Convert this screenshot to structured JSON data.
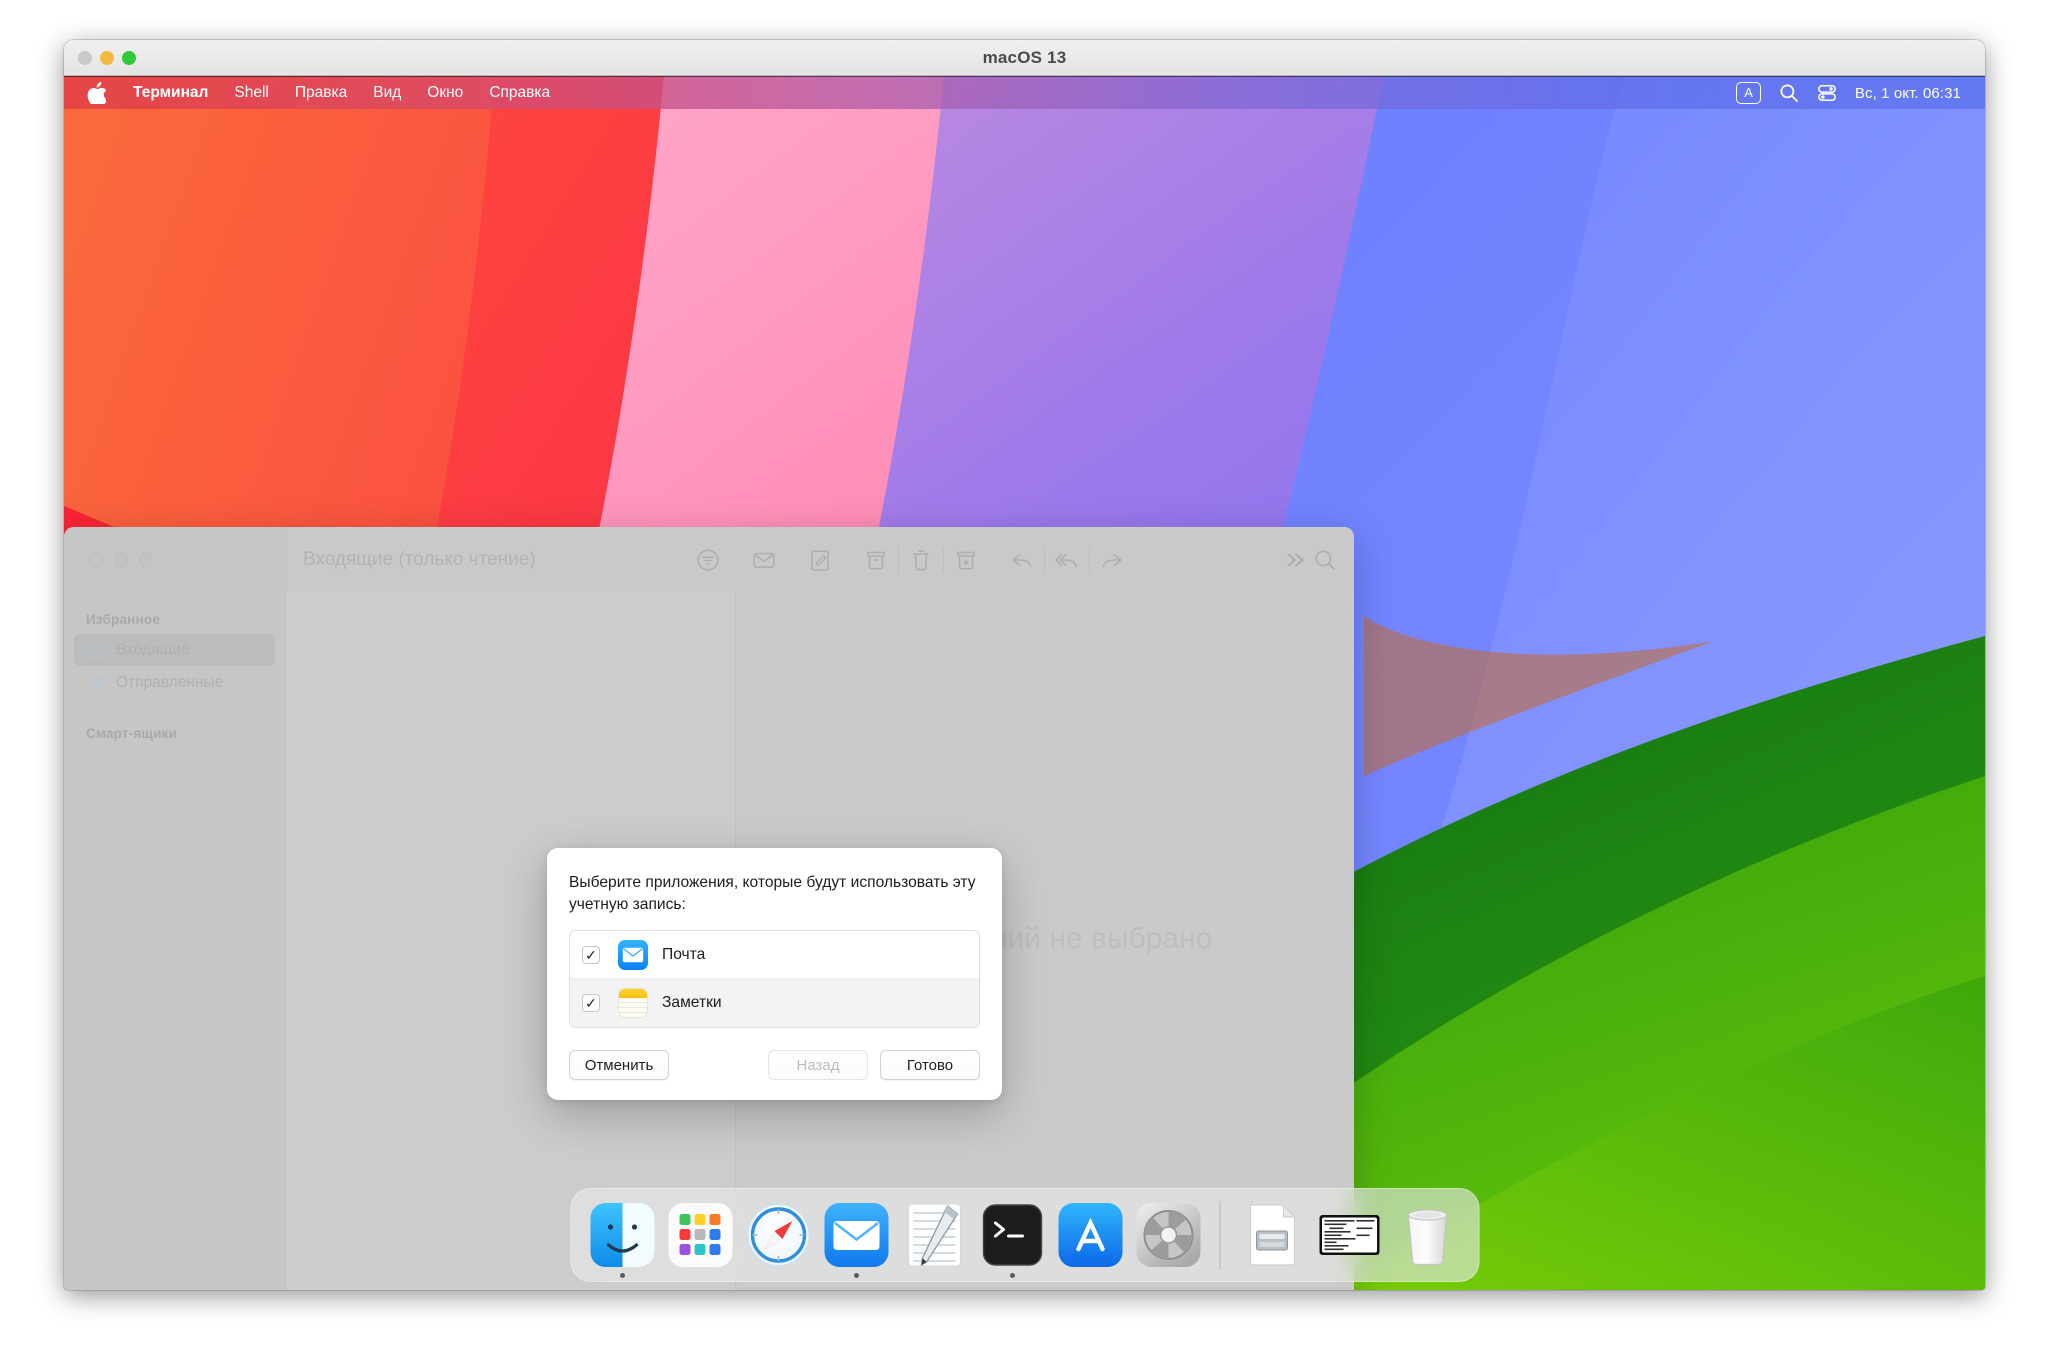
{
  "vm": {
    "title": "macOS 13",
    "lights": [
      "close",
      "minimize",
      "maximize"
    ]
  },
  "menubar": {
    "apple_icon": "apple-logo-icon",
    "items": [
      {
        "label": "Терминал",
        "bold": true
      },
      {
        "label": "Shell",
        "bold": false
      },
      {
        "label": "Правка",
        "bold": false
      },
      {
        "label": "Вид",
        "bold": false
      },
      {
        "label": "Окно",
        "bold": false
      },
      {
        "label": "Справка",
        "bold": false
      }
    ],
    "status": {
      "keyboard_badge": "A",
      "search_icon": "search-icon",
      "control_center_icon": "control-center-icon",
      "clock": "Вс, 1 окт.  06:31"
    }
  },
  "mail_window": {
    "list_title": "Входящие (только чтение)",
    "toolbar_icons": [
      "filter-icon",
      "mark-unread-icon",
      "compose-icon",
      "archive-icon",
      "trash-icon",
      "junk-icon",
      "reply-icon",
      "reply-all-icon",
      "forward-icon",
      "chevron-double-right-icon",
      "search-icon"
    ],
    "sidebar": {
      "sections": [
        {
          "title": "Избранное",
          "items": [
            {
              "label": "Входящие",
              "icon": "inbox-icon",
              "selected": true
            },
            {
              "label": "Отправленные",
              "icon": "paperplane-icon",
              "selected": false
            }
          ]
        },
        {
          "title": "Смарт-ящики",
          "items": []
        }
      ]
    },
    "preview_placeholder": "Сообщений не выбрано"
  },
  "sheet": {
    "prompt": "Выберите приложения, которые будут использовать эту учетную запись:",
    "apps": [
      {
        "name": "Почта",
        "icon": "mail-app-icon",
        "checked": true,
        "check_glyph": "✓"
      },
      {
        "name": "Заметки",
        "icon": "notes-app-icon",
        "checked": true,
        "check_glyph": "✓"
      }
    ],
    "buttons": {
      "cancel": "Отменить",
      "back": "Назад",
      "done": "Готово"
    }
  },
  "dock": {
    "items": [
      {
        "name": "Finder",
        "icon": "finder-icon",
        "running": true
      },
      {
        "name": "Launchpad",
        "icon": "launchpad-icon",
        "running": false
      },
      {
        "name": "Safari",
        "icon": "safari-icon",
        "running": false
      },
      {
        "name": "Почта",
        "icon": "mail-app-icon",
        "running": true
      },
      {
        "name": "TextEdit",
        "icon": "textedit-icon",
        "running": false
      },
      {
        "name": "Терминал",
        "icon": "terminal-icon",
        "running": true
      },
      {
        "name": "App Store",
        "icon": "appstore-icon",
        "running": false
      },
      {
        "name": "Системные настройки",
        "icon": "system-settings-icon",
        "running": false
      },
      {
        "name": "Диск-образ",
        "icon": "disk-document-icon",
        "running": false
      },
      {
        "name": "Окно Терминала",
        "icon": "minimized-window-icon",
        "running": false
      },
      {
        "name": "Корзина",
        "icon": "trash-icon",
        "running": false
      }
    ]
  },
  "colors": {
    "menubar_left": "#e03c46",
    "menubar_right": "#5c74f0",
    "wallpaper_red": "#fb3a3a",
    "wallpaper_pink": "#ff9ec4",
    "wallpaper_blue": "#6b7cff",
    "wallpaper_green": "#1e7a12",
    "dark_green": "#0b4d12",
    "accent_blue": "#0b82f5",
    "notes_yellow": "#ffd426"
  }
}
